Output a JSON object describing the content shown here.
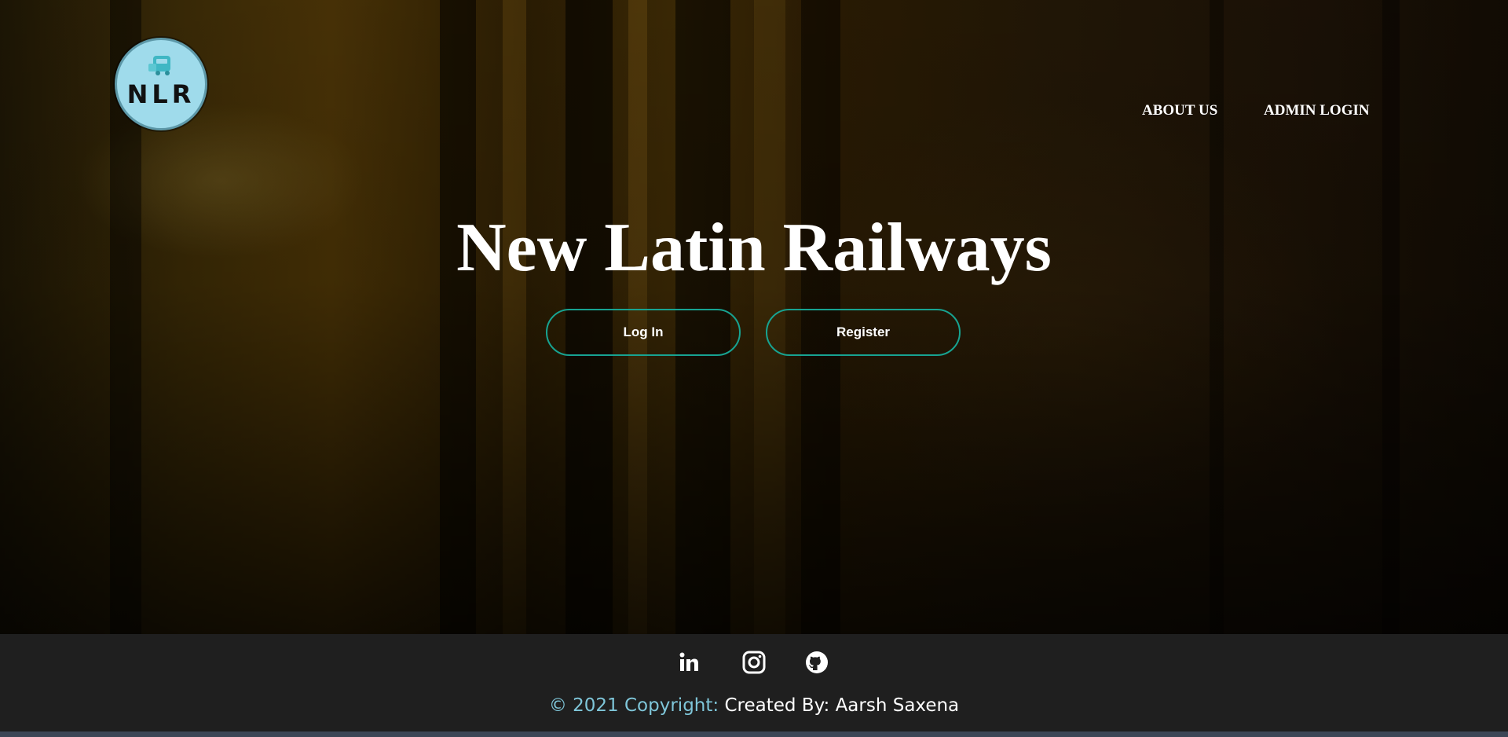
{
  "brand": {
    "logo_text": "NLR",
    "logo_color": "#9fdbeb"
  },
  "nav": {
    "about": "ABOUT US",
    "admin_login": "ADMIN LOGIN"
  },
  "hero": {
    "title": "New Latin Railways",
    "login_label": "Log In",
    "register_label": "Register",
    "button_border_color": "#17a391"
  },
  "footer": {
    "social_icons": [
      "linkedin-icon",
      "instagram-icon",
      "github-icon"
    ],
    "copyright_prefix": "© 2021 Copyright:",
    "copyright_author": "Created By: Aarsh Saxena"
  }
}
